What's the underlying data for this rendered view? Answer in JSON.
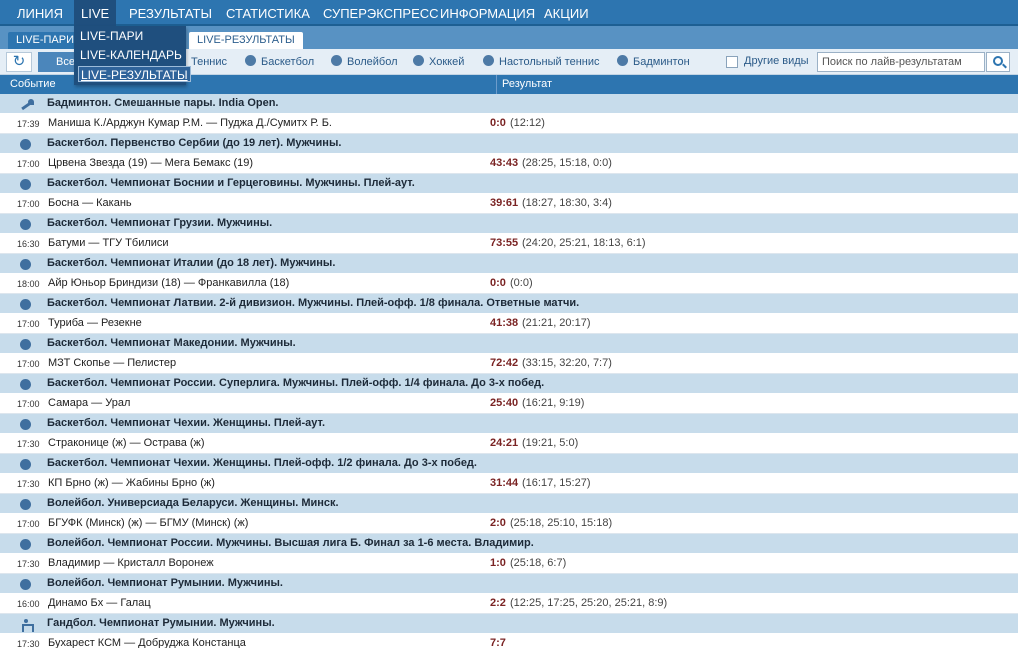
{
  "nav": {
    "items": [
      {
        "label": "ЛИНИЯ"
      },
      {
        "label": "LIVE"
      },
      {
        "label": "РЕЗУЛЬТАТЫ"
      },
      {
        "label": "СТАТИСТИКА"
      },
      {
        "label": "СУПЕРЭКСПРЕСС"
      },
      {
        "label": "ИНФОРМАЦИЯ"
      },
      {
        "label": "АКЦИИ"
      }
    ],
    "active": "LIVE"
  },
  "dropdown": {
    "items": [
      {
        "label": "LIVE-ПАРИ"
      },
      {
        "label": "LIVE-КАЛЕНДАРЬ"
      },
      {
        "label": "LIVE-РЕЗУЛЬТАТЫ"
      }
    ],
    "selected": "LIVE-РЕЗУЛЬТАТЫ"
  },
  "subtabs": {
    "tab1": "LIVE-ПАРИ",
    "tab3": "LIVE-РЕЗУЛЬТАТЫ"
  },
  "filters": {
    "all_label": "Все",
    "sports": [
      {
        "label": "Теннис",
        "icon": "tennis-icon"
      },
      {
        "label": "Баскетбол",
        "icon": "basketball-icon"
      },
      {
        "label": "Волейбол",
        "icon": "volleyball-icon"
      },
      {
        "label": "Хоккей",
        "icon": "hockey-icon"
      },
      {
        "label": "Настольный теннис",
        "icon": "table-tennis-icon"
      },
      {
        "label": "Бадминтон",
        "icon": "badminton-icon"
      }
    ],
    "other_label": "Другие виды",
    "search_placeholder": "Поиск по лайв-результатам"
  },
  "columns": {
    "event": "Событие",
    "result": "Результат"
  },
  "groups": [
    {
      "title": "Бадминтон. Смешанные пары. India Open.",
      "icon": "badminton-icon",
      "events": [
        {
          "time": "17:39",
          "name": "Маниша К./Арджун Кумар Р.М. — Пуджа Д./Сумитх Р. Б.",
          "score": "0:0",
          "periods": "(12:12)"
        }
      ]
    },
    {
      "title": "Баскетбол. Первенство Сербии (до 19 лет). Мужчины.",
      "icon": "basketball-icon",
      "events": [
        {
          "time": "17:00",
          "name": "Црвена Звезда (19) — Мега Бемакс (19)",
          "score": "43:43",
          "periods": "(28:25, 15:18, 0:0)"
        }
      ]
    },
    {
      "title": "Баскетбол. Чемпионат Боснии и Герцеговины. Мужчины. Плей-аут.",
      "icon": "basketball-icon",
      "events": [
        {
          "time": "17:00",
          "name": "Босна — Какань",
          "score": "39:61",
          "periods": "(18:27, 18:30, 3:4)"
        }
      ]
    },
    {
      "title": "Баскетбол. Чемпионат Грузии. Мужчины.",
      "icon": "basketball-icon",
      "events": [
        {
          "time": "16:30",
          "name": "Батуми — ТГУ Тбилиси",
          "score": "73:55",
          "periods": "(24:20, 25:21, 18:13, 6:1)"
        }
      ]
    },
    {
      "title": "Баскетбол. Чемпионат Италии (до 18 лет). Мужчины.",
      "icon": "basketball-icon",
      "events": [
        {
          "time": "18:00",
          "name": "Айр Юньор Бриндизи (18) — Франкавилла (18)",
          "score": "0:0",
          "periods": "(0:0)"
        }
      ]
    },
    {
      "title": "Баскетбол. Чемпионат Латвии. 2-й дивизион. Мужчины. Плей-офф. 1/8 финала. Ответные матчи.",
      "icon": "basketball-icon",
      "events": [
        {
          "time": "17:00",
          "name": "Туриба — Резекне",
          "score": "41:38",
          "periods": "(21:21, 20:17)"
        }
      ]
    },
    {
      "title": "Баскетбол. Чемпионат Македонии. Мужчины.",
      "icon": "basketball-icon",
      "events": [
        {
          "time": "17:00",
          "name": "МЗТ Скопье — Пелистер",
          "score": "72:42",
          "periods": "(33:15, 32:20, 7:7)"
        }
      ]
    },
    {
      "title": "Баскетбол. Чемпионат России. Суперлига. Мужчины. Плей-офф. 1/4 финала. До 3-х побед.",
      "icon": "basketball-icon",
      "events": [
        {
          "time": "17:00",
          "name": "Самара — Урал",
          "score": "25:40",
          "periods": "(16:21, 9:19)"
        }
      ]
    },
    {
      "title": "Баскетбол. Чемпионат Чехии. Женщины. Плей-аут.",
      "icon": "basketball-icon",
      "events": [
        {
          "time": "17:30",
          "name": "Страконице (ж) — Острава (ж)",
          "score": "24:21",
          "periods": "(19:21, 5:0)"
        }
      ]
    },
    {
      "title": "Баскетбол. Чемпионат Чехии. Женщины. Плей-офф. 1/2 финала. До 3-х побед.",
      "icon": "basketball-icon",
      "events": [
        {
          "time": "17:30",
          "name": "КП Брно (ж) — Жабины Брно (ж)",
          "score": "31:44",
          "periods": "(16:17, 15:27)"
        }
      ]
    },
    {
      "title": "Волейбол. Универсиада Беларуси. Женщины. Минск.",
      "icon": "volleyball-icon",
      "events": [
        {
          "time": "17:00",
          "name": "БГУФК (Минск) (ж) — БГМУ (Минск) (ж)",
          "score": "2:0",
          "periods": "(25:18, 25:10, 15:18)"
        }
      ]
    },
    {
      "title": "Волейбол. Чемпионат России. Мужчины. Высшая лига Б. Финал за 1-6 места. Владимир.",
      "icon": "volleyball-icon",
      "events": [
        {
          "time": "17:30",
          "name": "Владимир — Кристалл Воронеж",
          "score": "1:0",
          "periods": "(25:18, 6:7)"
        }
      ]
    },
    {
      "title": "Волейбол. Чемпионат Румынии. Мужчины.",
      "icon": "volleyball-icon",
      "events": [
        {
          "time": "16:00",
          "name": "Динамо Бх — Галац",
          "score": "2:2",
          "periods": "(12:25, 17:25, 25:20, 25:21, 8:9)"
        }
      ]
    },
    {
      "title": "Гандбол. Чемпионат Румынии. Мужчины.",
      "icon": "handball-icon",
      "events": [
        {
          "time": "17:30",
          "name": "Бухарест КСМ — Добруджа Констанца",
          "score": "7:7",
          "periods": ""
        }
      ]
    }
  ]
}
